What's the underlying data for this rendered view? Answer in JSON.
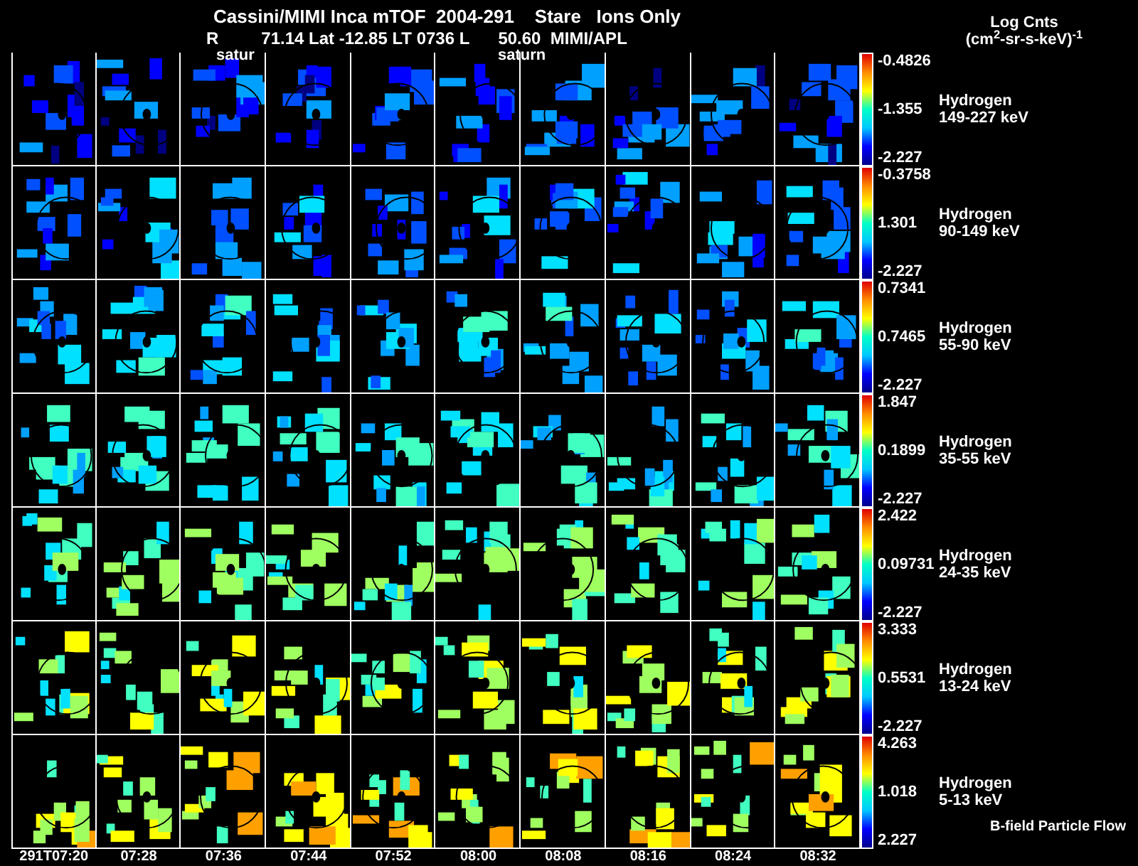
{
  "header": {
    "title": "Cassini/MIMI Inca mTOF  2004-291    Stare   Ions Only",
    "position": [
      "R",
      "71.14 Lat -12.85 LT 0736 L",
      "50.60  MIMI/APL"
    ],
    "units_title": "Log Cnts",
    "units": "(cm$^{2}$-sr-s-keV)$^{-1}$"
  },
  "planet_labels": [
    "satur",
    "saturn"
  ],
  "rows": [
    {
      "species": "Hydrogen",
      "energy": "149-227 keV",
      "scale_max": "-0.4826",
      "scale_mid": "-1.355",
      "scale_min": "-2.227"
    },
    {
      "species": "Hydrogen",
      "energy": "90-149 keV",
      "scale_max": "-0.3758",
      "scale_mid": "1.301",
      "scale_min": "-2.227"
    },
    {
      "species": "Hydrogen",
      "energy": "55-90 keV",
      "scale_max": "0.7341",
      "scale_mid": "0.7465",
      "scale_min": "-2.227"
    },
    {
      "species": "Hydrogen",
      "energy": "35-55 keV",
      "scale_max": "1.847",
      "scale_mid": "0.1899",
      "scale_min": "-2.227"
    },
    {
      "species": "Hydrogen",
      "energy": "24-35 keV",
      "scale_max": "2.422",
      "scale_mid": "0.09731",
      "scale_min": "-2.227"
    },
    {
      "species": "Hydrogen",
      "energy": "13-24 keV",
      "scale_max": "3.333",
      "scale_mid": "0.5531",
      "scale_min": "-2.227"
    },
    {
      "species": "Hydrogen",
      "energy": "5-13 keV",
      "scale_max": "4.263",
      "scale_mid": "1.018",
      "scale_min": "2.227"
    }
  ],
  "footnote": "B-field Particle Flow",
  "times": [
    "291T07:20",
    "07:28",
    "07:36",
    "07:44",
    "07:52",
    "08:00",
    "08:08",
    "08:16",
    "08:24",
    "08:32"
  ]
}
